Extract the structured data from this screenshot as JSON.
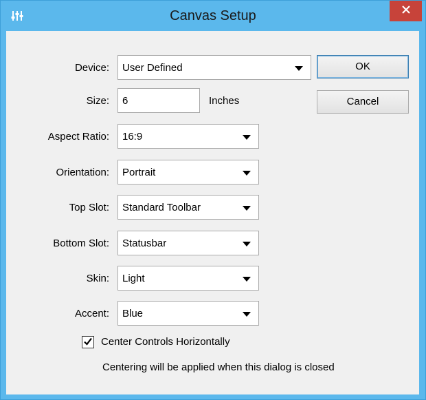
{
  "window": {
    "title": "Canvas Setup"
  },
  "labels": {
    "device": "Device:",
    "size": "Size:",
    "aspect_ratio": "Aspect Ratio:",
    "orientation": "Orientation:",
    "top_slot": "Top Slot:",
    "bottom_slot": "Bottom Slot:",
    "skin": "Skin:",
    "accent": "Accent:"
  },
  "fields": {
    "device": "User Defined",
    "size": "6",
    "size_unit": "Inches",
    "aspect_ratio": "16:9",
    "orientation": "Portrait",
    "top_slot": "Standard Toolbar",
    "bottom_slot": "Statusbar",
    "skin": "Light",
    "accent": "Blue"
  },
  "buttons": {
    "ok": "OK",
    "cancel": "Cancel"
  },
  "center": {
    "checked": true,
    "label": "Center Controls Horizontally",
    "note": "Centering will be applied when this dialog is closed"
  },
  "icons": {
    "app": "sliders-icon",
    "close": "close-icon",
    "dropdown": "chevron-down-icon",
    "check": "check-icon"
  },
  "colors": {
    "titlebar": "#5bb8ec",
    "close_button": "#c7433a",
    "dialog_bg": "#f0f0f0"
  }
}
